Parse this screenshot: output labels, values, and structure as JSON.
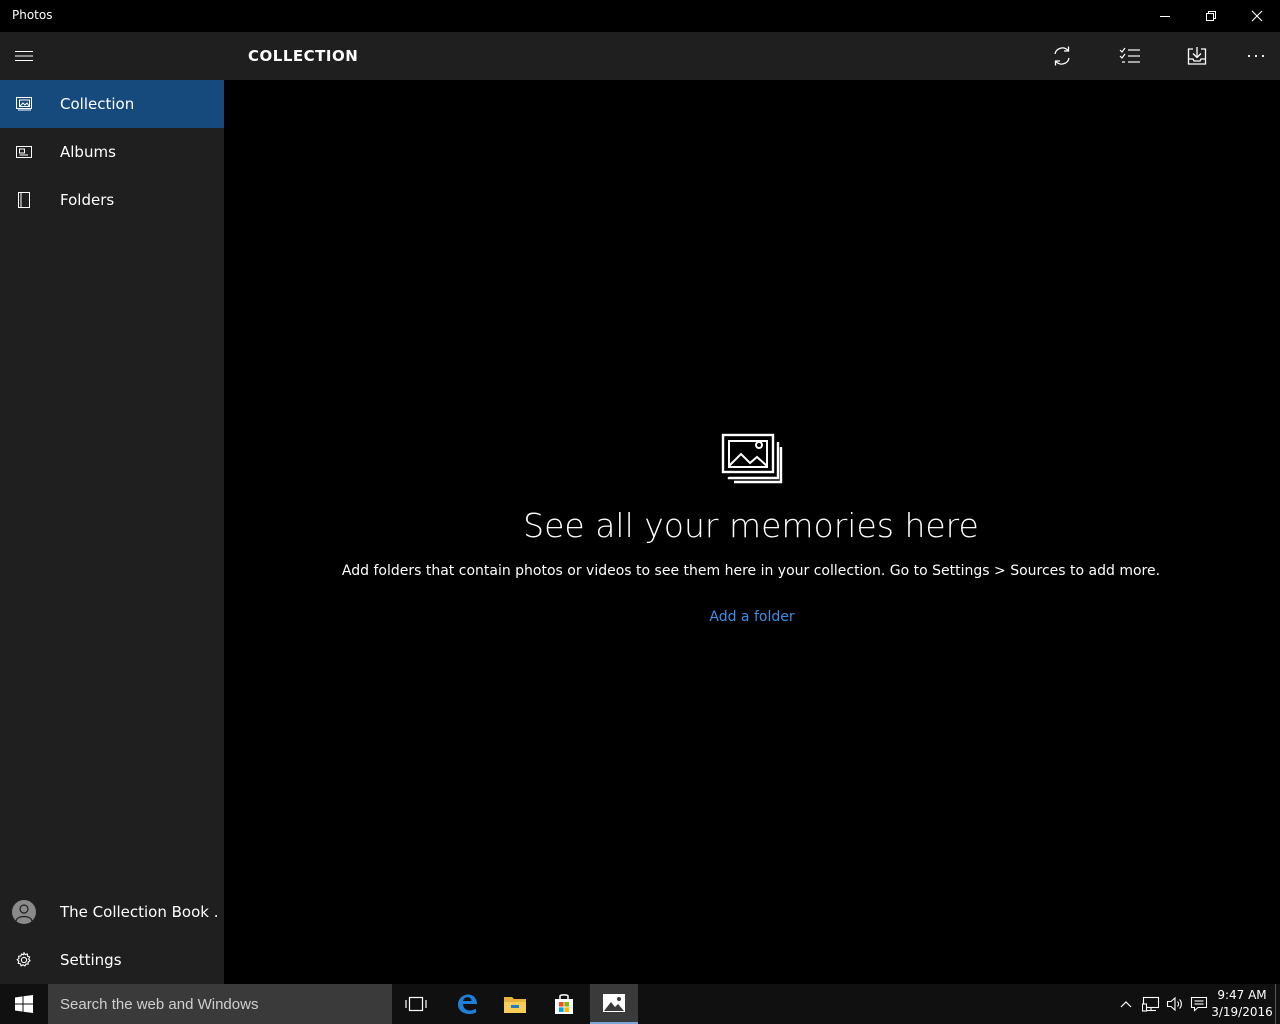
{
  "window": {
    "title": "Photos",
    "controls": [
      "minimize",
      "restore",
      "close"
    ]
  },
  "sidebar": {
    "menu_icon": "hamburger-icon",
    "items": [
      {
        "label": "Collection",
        "icon": "collection-icon",
        "active": true
      },
      {
        "label": "Albums",
        "icon": "album-icon",
        "active": false
      },
      {
        "label": "Folders",
        "icon": "folder-icon",
        "active": false
      }
    ],
    "account": {
      "label": "The Collection Book .",
      "icon": "avatar"
    },
    "settings": {
      "label": "Settings",
      "icon": "gear-icon"
    }
  },
  "header": {
    "title": "COLLECTION",
    "actions": [
      "refresh-icon",
      "select-icon",
      "import-icon",
      "more-icon"
    ]
  },
  "main": {
    "empty_icon": "photos-stack-icon",
    "title": "See all your memories here",
    "description": "Add folders that contain photos or videos to see them here in your collection. Go to Settings > Sources to add more.",
    "action_link": "Add a folder"
  },
  "taskbar": {
    "search_placeholder": "Search the web and Windows",
    "apps": [
      "task-view-icon",
      "edge-icon",
      "file-explorer-icon",
      "store-icon",
      "photos-icon"
    ],
    "time": "9:47 AM",
    "date": "3/19/2016"
  },
  "colors": {
    "accent": "#174a7c",
    "link": "#3d8ee8",
    "sidebar_bg": "#1f1f1f",
    "main_bg": "#000000"
  }
}
